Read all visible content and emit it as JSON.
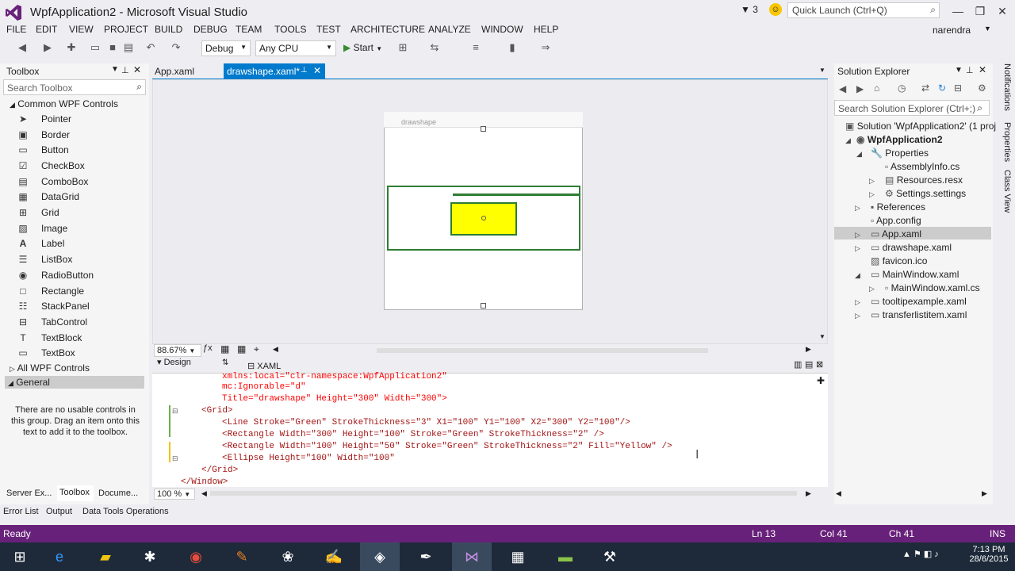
{
  "window": {
    "title": "WpfApplication2 - Microsoft Visual Studio",
    "filter_count": "3",
    "quick_launch": "Quick Launch (Ctrl+Q)",
    "user": "narendra"
  },
  "menu": [
    "FILE",
    "EDIT",
    "VIEW",
    "PROJECT",
    "BUILD",
    "DEBUG",
    "TEAM",
    "TOOLS",
    "TEST",
    "ARCHITECTURE",
    "ANALYZE",
    "WINDOW",
    "HELP"
  ],
  "toolbar": {
    "config": "Debug",
    "platform": "Any CPU",
    "start": "Start"
  },
  "toolbox": {
    "title": "Toolbox",
    "search_placeholder": "Search Toolbox",
    "group": "Common WPF Controls",
    "items": [
      "Pointer",
      "Border",
      "Button",
      "CheckBox",
      "ComboBox",
      "DataGrid",
      "Grid",
      "Image",
      "Label",
      "ListBox",
      "RadioButton",
      "Rectangle",
      "StackPanel",
      "TabControl",
      "TextBlock",
      "TextBox"
    ],
    "all_group": "All WPF Controls",
    "general": "General",
    "empty_msg": "There are no usable controls in this group. Drag an item onto this text to add it to the toolbox.",
    "bottom_tabs": [
      "Server Ex...",
      "Toolbox",
      "Docume..."
    ]
  },
  "tabs": [
    {
      "label": "App.xaml"
    },
    {
      "label": "drawshape.xaml*"
    }
  ],
  "designer": {
    "window_title": "drawshape",
    "zoom": "88.67%",
    "design_tab": "Design",
    "xaml_tab": "XAML"
  },
  "code": {
    "zoom": "100 %",
    "lines": [
      "xmlns:local=\"clr-namespace:WpfApplication2\"",
      "mc:Ignorable=\"d\"",
      "Title=\"drawshape\" Height=\"300\" Width=\"300\">",
      "<Grid>",
      "<Line Stroke=\"Green\" StrokeThickness=\"3\" X1=\"100\" Y1=\"100\" X2=\"300\" Y2=\"100\"/>",
      "<Rectangle Width=\"300\" Height=\"100\" Stroke=\"Green\" StrokeThickness=\"2\" />",
      "<Rectangle Width=\"100\" Height=\"50\" Stroke=\"Green\" StrokeThickness=\"2\" Fill=\"Yellow\" />",
      "<Ellipse Height=\"100\" Width=\"100\"",
      "</Grid>",
      "</Window>"
    ]
  },
  "solution": {
    "title": "Solution Explorer",
    "search_placeholder": "Search Solution Explorer (Ctrl+;)",
    "items": [
      {
        "label": "Solution 'WpfApplication2' (1 proj"
      },
      {
        "label": "WpfApplication2"
      },
      {
        "label": "Properties"
      },
      {
        "label": "AssemblyInfo.cs"
      },
      {
        "label": "Resources.resx"
      },
      {
        "label": "Settings.settings"
      },
      {
        "label": "References"
      },
      {
        "label": "App.config"
      },
      {
        "label": "App.xaml"
      },
      {
        "label": "drawshape.xaml"
      },
      {
        "label": "favicon.ico"
      },
      {
        "label": "MainWindow.xaml"
      },
      {
        "label": "MainWindow.xaml.cs"
      },
      {
        "label": "tooltipexample.xaml"
      },
      {
        "label": "transferlistitem.xaml"
      }
    ]
  },
  "side_tabs": [
    "Notifications",
    "Properties",
    "Class View"
  ],
  "bottom_panel_tabs": [
    "Error List",
    "Output",
    "Data Tools Operations"
  ],
  "status": {
    "ready": "Ready",
    "ln": "Ln 13",
    "col": "Col 41",
    "ch": "Ch 41",
    "ins": "INS"
  },
  "taskbar": {
    "time": "7:13 PM",
    "date": "28/6/2015"
  },
  "colors": {
    "accent": "#68217a",
    "tab_active": "#007acc",
    "rect_stroke": "#2e7d32",
    "fill_yellow": "#ffff00"
  }
}
